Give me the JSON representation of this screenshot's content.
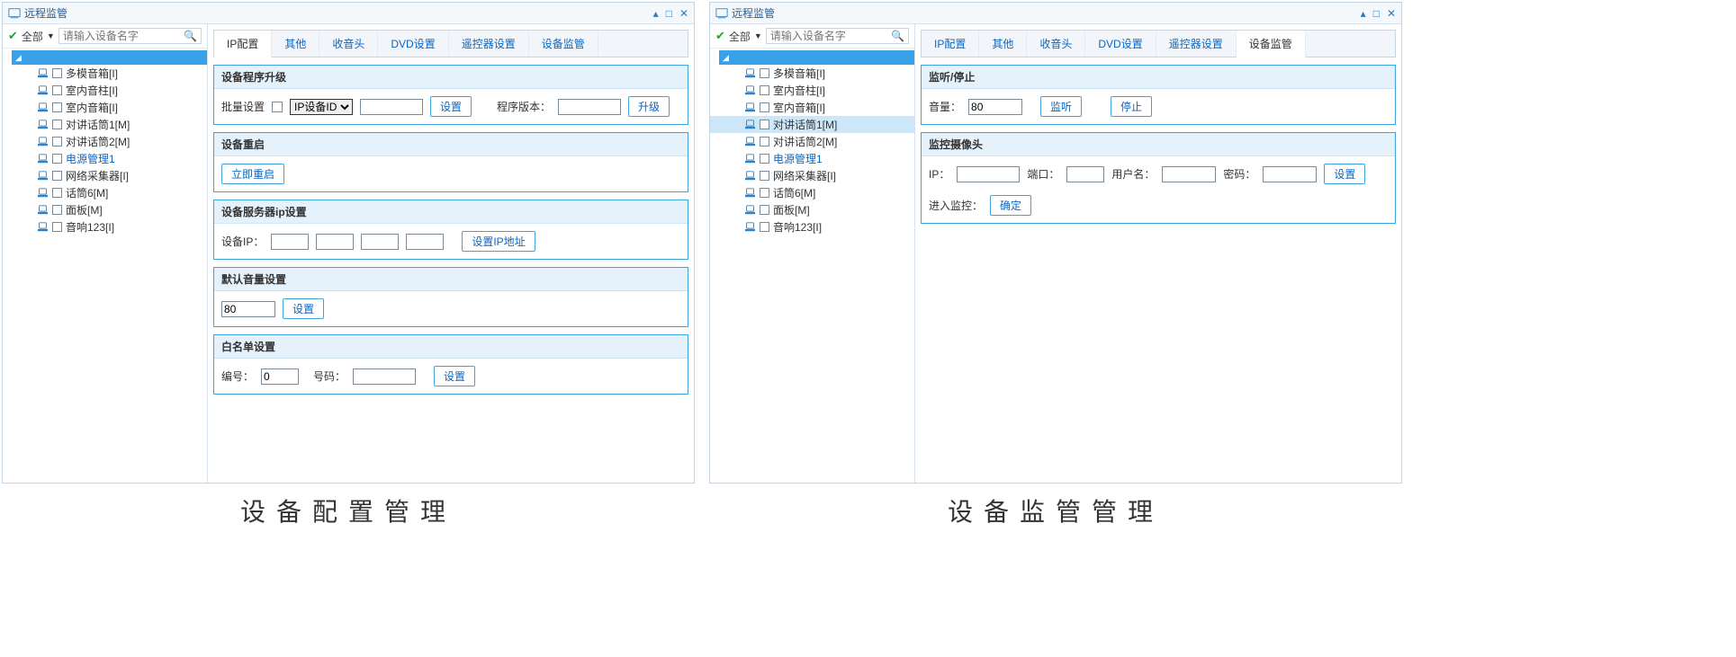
{
  "window_title": "远程监管",
  "sidebar": {
    "all_label": "全部",
    "search_placeholder": "请输入设备名字",
    "items": [
      {
        "label": "多模音箱[I]"
      },
      {
        "label": "室内音柱[I]"
      },
      {
        "label": "室内音箱[I]"
      },
      {
        "label": "对讲话筒1[M]"
      },
      {
        "label": "对讲话筒2[M]"
      },
      {
        "label": "电源管理1"
      },
      {
        "label": "网络采集器[I]"
      },
      {
        "label": "话筒6[M]"
      },
      {
        "label": "面板[M]"
      },
      {
        "label": "音响123[I]"
      }
    ]
  },
  "tabs": [
    "IP配置",
    "其他",
    "收音头",
    "DVD设置",
    "遥控器设置",
    "设备监管"
  ],
  "left": {
    "active_tab": 0,
    "active_tree": 5,
    "caption": "设备配置管理",
    "p1": {
      "title": "设备程序升级",
      "batch_label": "批量设置",
      "select_opt": "IP设备ID",
      "btn_set": "设置",
      "ver_label": "程序版本：",
      "btn_upgrade": "升级"
    },
    "p2": {
      "title": "设备重启",
      "btn": "立即重启"
    },
    "p3": {
      "title": "设备服务器ip设置",
      "label": "设备IP：",
      "btn": "设置IP地址"
    },
    "p4": {
      "title": "默认音量设置",
      "value": "80",
      "btn": "设置"
    },
    "p5": {
      "title": "白名单设置",
      "id_label": "编号：",
      "id_value": "0",
      "num_label": "号码：",
      "btn": "设置"
    }
  },
  "right": {
    "active_tab": 5,
    "highlight_tree": 3,
    "active_tree": 5,
    "caption": "设备监管管理",
    "p1": {
      "title": "监听/停止",
      "vol_label": "音量：",
      "vol_value": "80",
      "btn_listen": "监听",
      "btn_stop": "停止"
    },
    "p2": {
      "title": "监控摄像头",
      "ip_label": "IP：",
      "port_label": "端口：",
      "user_label": "用户名：",
      "pwd_label": "密码：",
      "btn_set": "设置",
      "enter_label": "进入监控：",
      "btn_ok": "确定"
    }
  }
}
